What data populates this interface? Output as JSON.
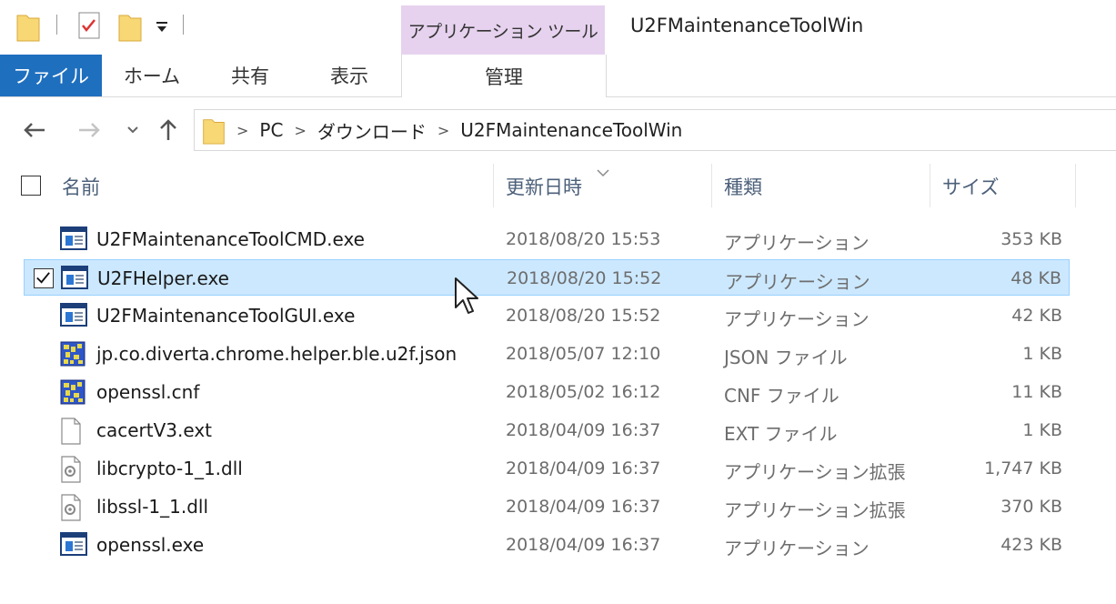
{
  "title_bar": {
    "contextual_tab_header": "アプリケーション ツール",
    "window_title": "U2FMaintenanceToolWin"
  },
  "ribbon": {
    "tabs": [
      {
        "label": "ファイル",
        "active": true
      },
      {
        "label": "ホーム"
      },
      {
        "label": "共有"
      },
      {
        "label": "表示"
      },
      {
        "label": "管理"
      }
    ]
  },
  "address": {
    "crumbs": [
      "PC",
      "ダウンロード",
      "U2FMaintenanceToolWin"
    ]
  },
  "columns": {
    "name": "名前",
    "date": "更新日時",
    "type": "種類",
    "size": "サイズ"
  },
  "files": [
    {
      "name": "U2FMaintenanceToolCMD.exe",
      "date": "2018/08/20 15:53",
      "type": "アプリケーション",
      "size": "353 KB",
      "icon": "exe-icon",
      "selected": false
    },
    {
      "name": "U2FHelper.exe",
      "date": "2018/08/20 15:52",
      "type": "アプリケーション",
      "size": "48 KB",
      "icon": "exe-icon",
      "selected": true
    },
    {
      "name": "U2FMaintenanceToolGUI.exe",
      "date": "2018/08/20 15:52",
      "type": "アプリケーション",
      "size": "42 KB",
      "icon": "exe-icon",
      "selected": false
    },
    {
      "name": "jp.co.diverta.chrome.helper.ble.u2f.json",
      "date": "2018/05/07 12:10",
      "type": "JSON ファイル",
      "size": "1 KB",
      "icon": "config-icon",
      "selected": false
    },
    {
      "name": "openssl.cnf",
      "date": "2018/05/02 16:12",
      "type": "CNF ファイル",
      "size": "11 KB",
      "icon": "config-icon",
      "selected": false
    },
    {
      "name": "cacertV3.ext",
      "date": "2018/04/09 16:37",
      "type": "EXT ファイル",
      "size": "1 KB",
      "icon": "blank-file-icon",
      "selected": false
    },
    {
      "name": "libcrypto-1_1.dll",
      "date": "2018/04/09 16:37",
      "type": "アプリケーション拡張",
      "size": "1,747 KB",
      "icon": "dll-icon",
      "selected": false
    },
    {
      "name": "libssl-1_1.dll",
      "date": "2018/04/09 16:37",
      "type": "アプリケーション拡張",
      "size": "370 KB",
      "icon": "dll-icon",
      "selected": false
    },
    {
      "name": "openssl.exe",
      "date": "2018/04/09 16:37",
      "type": "アプリケーション",
      "size": "423 KB",
      "icon": "exe-icon",
      "selected": false
    }
  ],
  "colors": {
    "file_tab_bg": "#1f6fbf",
    "contextual_header_bg": "#e6d2ee",
    "selection_bg": "#cce8ff",
    "selection_border": "#99d1ff"
  }
}
